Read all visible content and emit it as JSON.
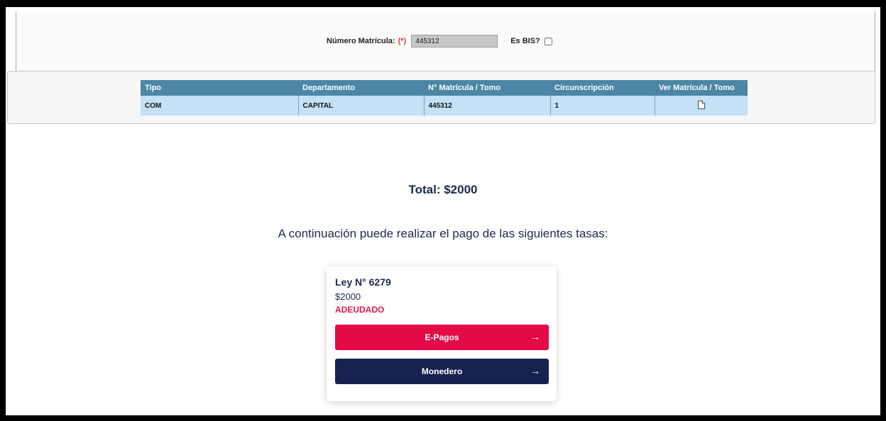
{
  "search": {
    "label": "Número Matrícula:",
    "required_mark": "(*)",
    "value": "445312",
    "bis_label": "Es BIS?"
  },
  "results": {
    "headers": [
      "Tipo",
      "Departamento",
      "N° Matrícula / Tomo",
      "Circunscripción",
      "Ver Matrícula / Tomo"
    ],
    "rows": [
      {
        "tipo": "COM",
        "departamento": "CAPITAL",
        "matricula": "445312",
        "circunscripcion": "1",
        "ver_icon": "document-icon"
      }
    ]
  },
  "summary": {
    "total": "Total: $2000",
    "instruction": "A continuación puede realizar el pago de las siguientes tasas:"
  },
  "tasa_card": {
    "title": "Ley N° 6279",
    "amount": "$2000",
    "status": "ADEUDADO",
    "epagos_label": "E-Pagos",
    "monedero_label": "Monedero",
    "arrow_glyph": "→"
  },
  "colors": {
    "header_blue": "#4b86a6",
    "row_blue": "#c4e1f5",
    "navy": "#17224f",
    "pink": "#e40a47",
    "status_red": "#e8174a"
  }
}
